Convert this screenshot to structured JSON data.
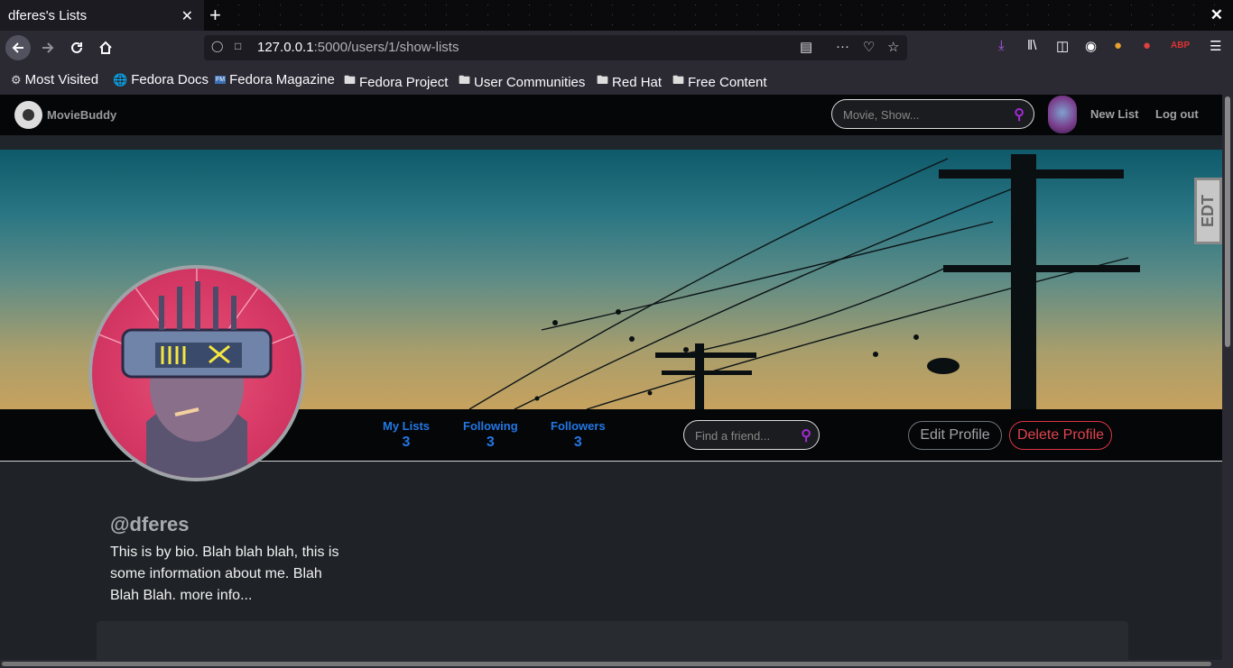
{
  "browser": {
    "tab_title": "dferes's Lists",
    "tab_close": "✕",
    "new_tab": "+",
    "window_close": "✕",
    "url_host": "127.0.0.1",
    "url_rest": ":5000/users/1/show-lists",
    "bookmarks": [
      {
        "label": "Most Visited",
        "icon": "gear-icon"
      },
      {
        "label": "Fedora Docs",
        "icon": "globe-icon"
      },
      {
        "label": "Fedora Magazine",
        "icon": "fm-icon"
      },
      {
        "label": "Fedora Project",
        "icon": "folder-icon"
      },
      {
        "label": "User Communities",
        "icon": "folder-icon"
      },
      {
        "label": "Red Hat",
        "icon": "folder-icon"
      },
      {
        "label": "Free Content",
        "icon": "folder-icon"
      }
    ]
  },
  "site": {
    "brand": "MovieBuddy",
    "search_placeholder": "Movie, Show...",
    "nav_new_list": "New List",
    "nav_logout": "Log out",
    "side_tab": "EDT",
    "stats": {
      "my_lists_label": "My Lists",
      "my_lists_count": "3",
      "following_label": "Following",
      "following_count": "3",
      "followers_label": "Followers",
      "followers_count": "3"
    },
    "friend_search_placeholder": "Find a friend...",
    "edit_profile": "Edit Profile",
    "delete_profile": "Delete Profile",
    "handle": "@dferes",
    "bio": "This is by bio. Blah blah blah, this is some information about me. Blah Blah Blah. more info..."
  },
  "colors": {
    "accent_blue": "#2278e6",
    "search_icon": "#a12bd4",
    "danger": "#dc3545"
  }
}
